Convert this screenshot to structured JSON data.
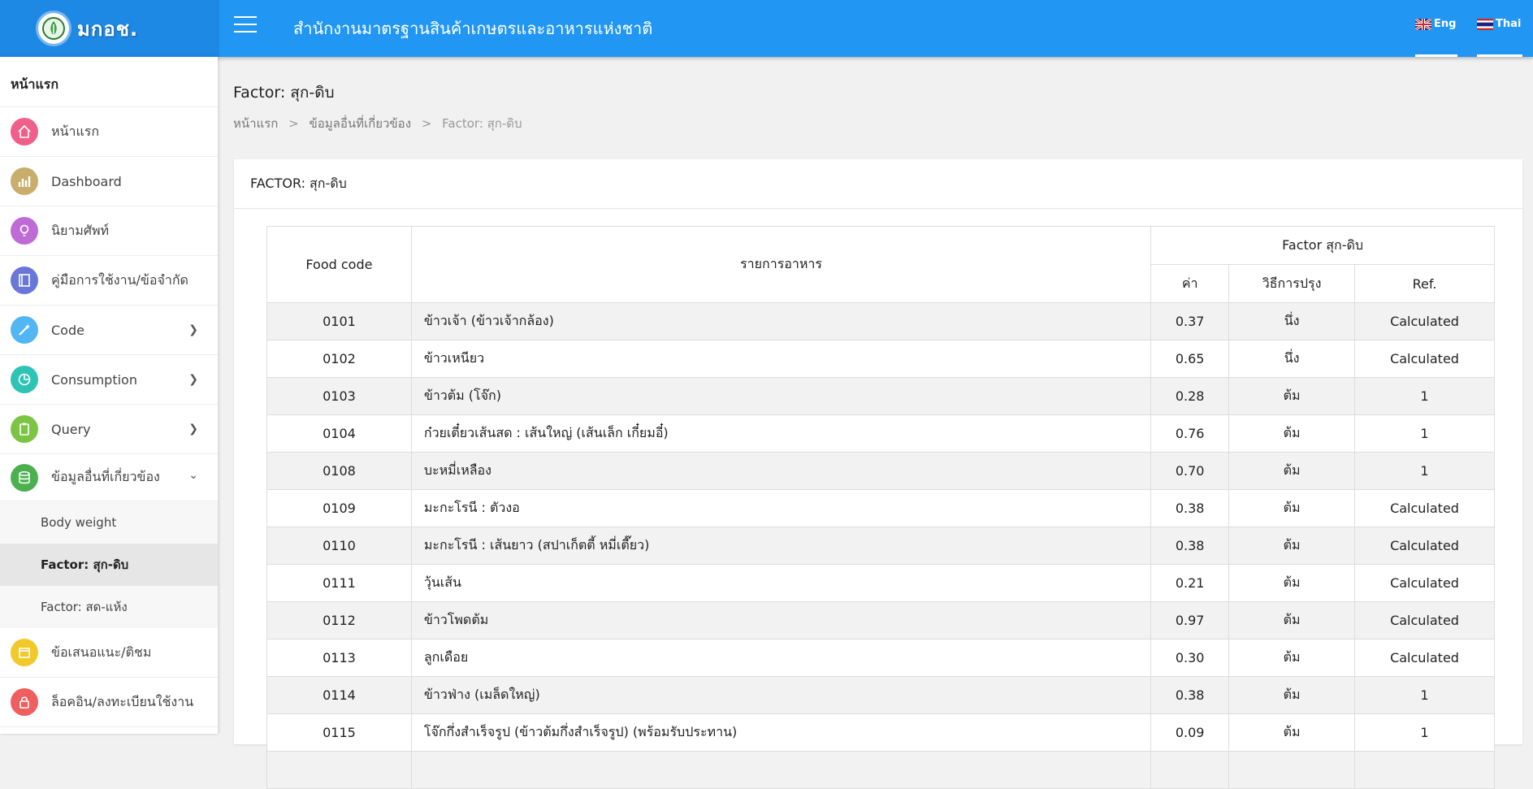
{
  "header": {
    "brand": "มกอช.",
    "title": "สำนักงานมาตรฐานสินค้าเกษตรและอาหารแห่งชาติ",
    "lang_en": "Eng",
    "lang_th": "Thai"
  },
  "sidebar": {
    "header": "หน้าแรก",
    "items": [
      {
        "label": "หน้าแรก",
        "icon": "home-icon",
        "color": "#ef5f8a"
      },
      {
        "label": "Dashboard",
        "icon": "bar-chart-icon",
        "color": "#c9ad6d"
      },
      {
        "label": "นิยามศัพท์",
        "icon": "lightbulb-icon",
        "color": "#bf6bd6"
      },
      {
        "label": "คู่มือการใช้งาน/ข้อจำกัด",
        "icon": "book-icon",
        "color": "#6a77d8"
      },
      {
        "label": "Code",
        "icon": "magic-wand-icon",
        "color": "#52b6f2"
      },
      {
        "label": "Consumption",
        "icon": "pie-chart-icon",
        "color": "#2ec3b5"
      },
      {
        "label": "Query",
        "icon": "clipboard-icon",
        "color": "#7cc444"
      },
      {
        "label": "ข้อมูลอื่นที่เกี่ยวข้อง",
        "icon": "database-icon",
        "color": "#4cb050"
      },
      {
        "label": "ข้อเสนอแนะ/ติชม",
        "icon": "calendar-icon",
        "color": "#f2c92a"
      },
      {
        "label": "ล็อคอิน/ลงทะเบียนใช้งาน",
        "icon": "lock-icon",
        "color": "#ef5f5f"
      }
    ],
    "sub_items": [
      "Body weight",
      "Factor: สุก-ดิบ",
      "Factor: สด-แห้ง"
    ]
  },
  "page": {
    "title": "Factor: สุก-ดิบ",
    "breadcrumb": [
      "หน้าแรก",
      "ข้อมูลอื่นที่เกี่ยวข้อง",
      "Factor: สุก-ดิบ"
    ],
    "breadcrumb_sep": ">",
    "card_title": "FACTOR: สุก-ดิบ"
  },
  "table": {
    "headers": {
      "food_code": "Food code",
      "food_name": "รายการอาหาร",
      "factor_group": "Factor สุก-ดิบ",
      "value": "ค่า",
      "method": "วิธีการปรุง",
      "ref": "Ref."
    },
    "rows": [
      {
        "code": "0101",
        "name": "ข้าวเจ้า (ข้าวเจ้ากล้อง)",
        "value": "0.37",
        "method": "นึ่ง",
        "ref": "Calculated"
      },
      {
        "code": "0102",
        "name": "ข้าวเหนียว",
        "value": "0.65",
        "method": "นึ่ง",
        "ref": "Calculated"
      },
      {
        "code": "0103",
        "name": "ข้าวต้ม (โจ๊ก)",
        "value": "0.28",
        "method": "ต้ม",
        "ref": "1"
      },
      {
        "code": "0104",
        "name": "ก๋วยเตี๋ยวเส้นสด : เส้นใหญ่ (เส้นเล็ก เกี๋ยมอี๋)",
        "value": "0.76",
        "method": "ต้ม",
        "ref": "1"
      },
      {
        "code": "0108",
        "name": "บะหมี่เหลือง",
        "value": "0.70",
        "method": "ต้ม",
        "ref": "1"
      },
      {
        "code": "0109",
        "name": "มะกะโรนี : ตัวงอ",
        "value": "0.38",
        "method": "ต้ม",
        "ref": "Calculated"
      },
      {
        "code": "0110",
        "name": "มะกะโรนี : เส้นยาว (สปาเก็ตตี้ หมี่เตี๊ยว)",
        "value": "0.38",
        "method": "ต้ม",
        "ref": "Calculated"
      },
      {
        "code": "0111",
        "name": "วุ้นเส้น",
        "value": "0.21",
        "method": "ต้ม",
        "ref": "Calculated"
      },
      {
        "code": "0112",
        "name": "ข้าวโพดต้ม",
        "value": "0.97",
        "method": "ต้ม",
        "ref": "Calculated"
      },
      {
        "code": "0113",
        "name": "ลูกเดือย",
        "value": "0.30",
        "method": "ต้ม",
        "ref": "Calculated"
      },
      {
        "code": "0114",
        "name": "ข้าวฟ่าง (เมล็ดใหญ่)",
        "value": "0.38",
        "method": "ต้ม",
        "ref": "1"
      },
      {
        "code": "0115",
        "name": "โจ๊กกึ่งสำเร็จรูป (ข้าวต้มกึ่งสำเร็จรูป) (พร้อมรับประทาน)",
        "value": "0.09",
        "method": "ต้ม",
        "ref": "1"
      },
      {
        "code": "",
        "name": "",
        "value": "",
        "method": "",
        "ref": ""
      }
    ]
  }
}
